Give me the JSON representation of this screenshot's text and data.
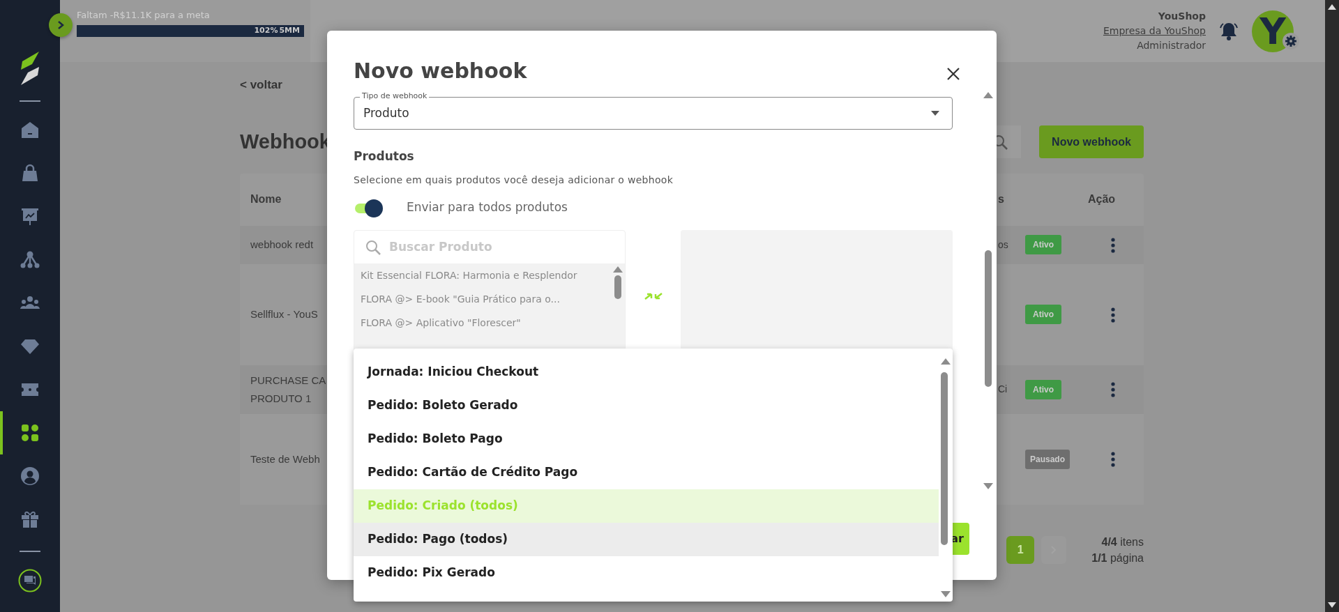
{
  "sidebar": {
    "items": [
      {
        "selected": false
      },
      {
        "selected": false
      },
      {
        "selected": false
      },
      {
        "selected": false
      },
      {
        "selected": false
      },
      {
        "selected": false
      },
      {
        "selected": false
      },
      {
        "selected": true
      },
      {
        "selected": false
      },
      {
        "selected": false
      }
    ]
  },
  "header": {
    "goal_text": "Faltam -R$11.1K para a meta",
    "progress": {
      "level": 1,
      "percent": "102%",
      "target": "5MM"
    },
    "company": "YouShop",
    "company_link": "Empresa da YouShop",
    "role": "Administrador",
    "avatar_letter": "Y"
  },
  "page": {
    "back_link": "< voltar",
    "title": "Webhook",
    "new_button": "Novo webhook",
    "table": {
      "columns": [
        "Nome",
        "s",
        "Ação"
      ],
      "rows": [
        {
          "name": "webhook redt",
          "column_2": "os",
          "status": "Ativo",
          "color": "#3f9a45"
        },
        {
          "name": "Sellflux - YouS",
          "status": "Ativo",
          "color": "#3f9a45"
        },
        {
          "name": "PURCHASE CA\nPRODUTO 1",
          "column_2": "Ci",
          "status": "Ativo",
          "color": "#3f9a45"
        },
        {
          "name": "Teste de Webh",
          "status": "Pausado",
          "color": "#6e6e6e"
        }
      ]
    },
    "pagination": {
      "pages": [
        {
          "label": "1",
          "selected": true
        }
      ],
      "items": "**4/4** itens",
      "pages_info": "**1/1** página"
    }
  },
  "modal": {
    "title": "Novo webhook",
    "type_field": {
      "label": "Tipo de webhook",
      "value": "Produto"
    },
    "products_heading": "Produtos",
    "products_hint": "Selecione em quais produtos você deseja adicionar o webhook",
    "send_all": {
      "label": "Enviar para todos produtos",
      "on": true
    },
    "search": {
      "placeholder": "Buscar Produto"
    },
    "products": [
      "Kit Essencial FLORA: Harmonia e Resplendor",
      "FLORA @> E-book \"Guia Prático para o...",
      "FLORA @> Aplicativo \"Florescer\""
    ],
    "save_button": "ar",
    "dropdown": {
      "options": [
        {
          "label": "Jornada: Iniciou Checkout",
          "selected": false,
          "hovered": false
        },
        {
          "label": "Pedido: Boleto Gerado",
          "selected": false,
          "hovered": false
        },
        {
          "label": "Pedido: Boleto Pago",
          "selected": false,
          "hovered": false
        },
        {
          "label": "Pedido: Cartão de Crédito Pago",
          "selected": false,
          "hovered": false
        },
        {
          "label": "Pedido: Criado (todos)",
          "selected": true,
          "hovered": false
        },
        {
          "label": "Pedido: Pago (todos)",
          "selected": false,
          "hovered": true
        },
        {
          "label": "Pedido: Pix Gerado",
          "selected": false,
          "hovered": false
        }
      ]
    }
  }
}
